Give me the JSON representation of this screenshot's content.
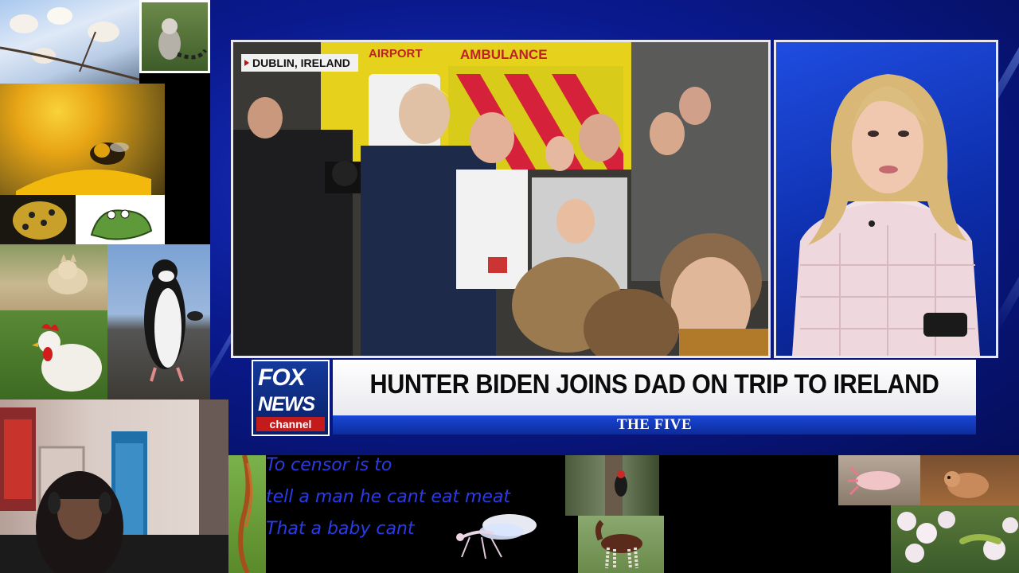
{
  "broadcast": {
    "dateline": "DUBLIN, IRELAND",
    "scene_signs": {
      "airport": "AIRPORT",
      "ambulance": "AMBULANCE"
    },
    "network": {
      "logo_top": "FOX",
      "logo_middle": "NEWS",
      "logo_bottom": "channel"
    },
    "headline": "HUNTER BIDEN JOINS DAD ON TRIP TO IRELAND",
    "show_name": "THE FIVE"
  },
  "overlay_caption": {
    "lines": [
      "To censor is to",
      "tell a man he cant eat meat",
      "That a baby cant"
    ]
  },
  "tiles": {
    "left_column": [
      "magnolia-photo",
      "lemur-photo",
      "bee-on-flower-photo",
      "pufferfish-photo",
      "cartoon-frog-image",
      "sand-kitten-photo",
      "penguin-photo",
      "rooster-photo"
    ],
    "bottom_row": [
      "webcam-streamer",
      "red-plant-photo",
      "mantis-image",
      "woodpecker-photo",
      "okapi-photo",
      "axolotl-photo",
      "mouse-photo",
      "flowers-caterpillar-photo"
    ]
  },
  "colors": {
    "fox_blue": "#0c2c9c",
    "fox_red": "#c31b1b",
    "caption_blue": "#2b3be8"
  }
}
